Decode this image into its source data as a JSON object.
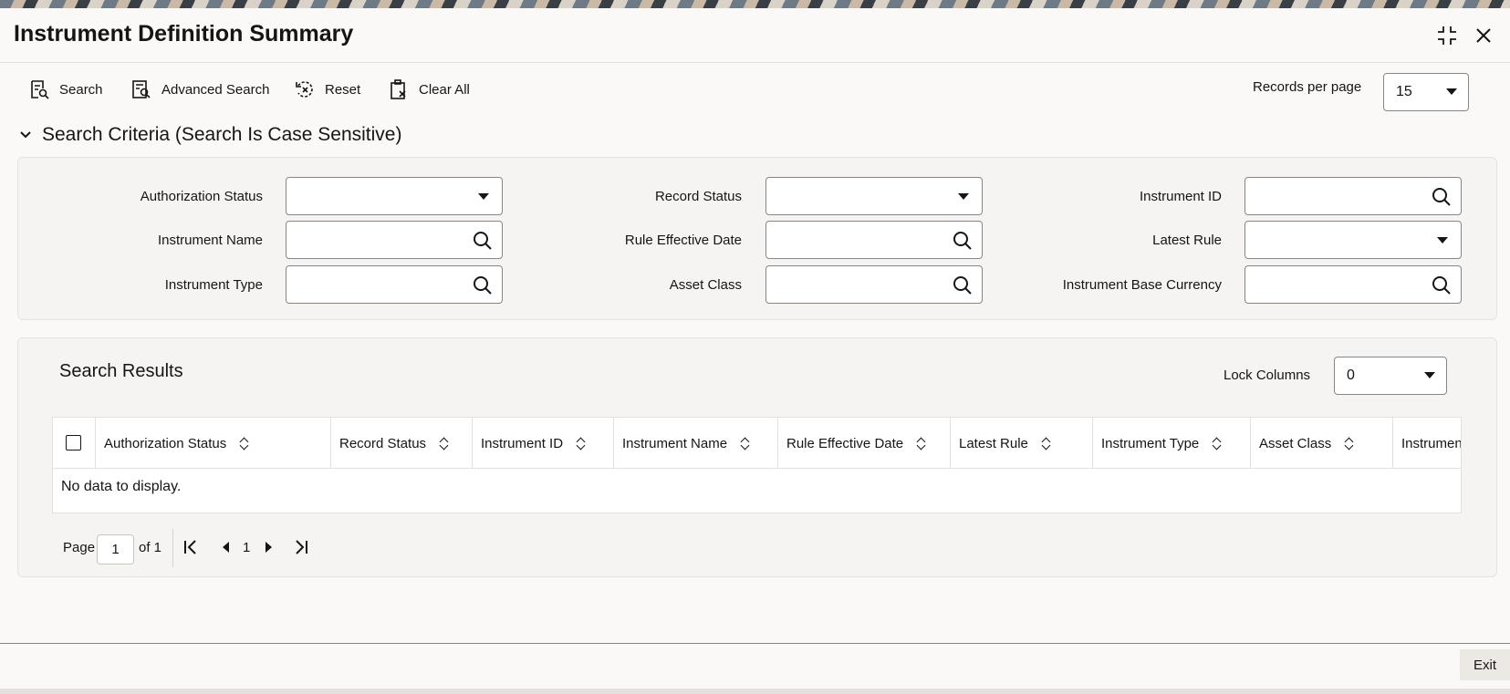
{
  "window": {
    "title": "Instrument Definition Summary",
    "maximize_icon": "collapse-arrows-icon",
    "close_icon": "close-icon"
  },
  "toolbar": {
    "search_label": "Search",
    "advanced_search_label": "Advanced Search",
    "reset_label": "Reset",
    "clear_all_label": "Clear All",
    "records_per_page_label": "Records per page",
    "records_per_page_value": "15"
  },
  "criteria": {
    "header": "Search Criteria (Search Is Case Sensitive)",
    "fields": {
      "authorization_status": {
        "label": "Authorization Status",
        "value": ""
      },
      "record_status": {
        "label": "Record Status",
        "value": ""
      },
      "instrument_id": {
        "label": "Instrument ID",
        "value": ""
      },
      "instrument_name": {
        "label": "Instrument Name",
        "value": ""
      },
      "rule_effective_date": {
        "label": "Rule Effective Date",
        "value": ""
      },
      "latest_rule": {
        "label": "Latest Rule",
        "value": ""
      },
      "instrument_type": {
        "label": "Instrument Type",
        "value": ""
      },
      "asset_class": {
        "label": "Asset Class",
        "value": ""
      },
      "instrument_base_currency": {
        "label": "Instrument Base Currency",
        "value": ""
      }
    }
  },
  "results": {
    "title": "Search Results",
    "lock_columns_label": "Lock Columns",
    "lock_columns_value": "0",
    "columns": [
      "Authorization Status",
      "Record Status",
      "Instrument ID",
      "Instrument Name",
      "Rule Effective Date",
      "Latest Rule",
      "Instrument Type",
      "Asset Class",
      "Instrument Base C"
    ],
    "empty_message": "No data to display."
  },
  "pagination": {
    "page_label": "Page",
    "current_page": "1",
    "of_label": "of 1",
    "page_number": "1"
  },
  "footer": {
    "exit_label": "Exit"
  }
}
